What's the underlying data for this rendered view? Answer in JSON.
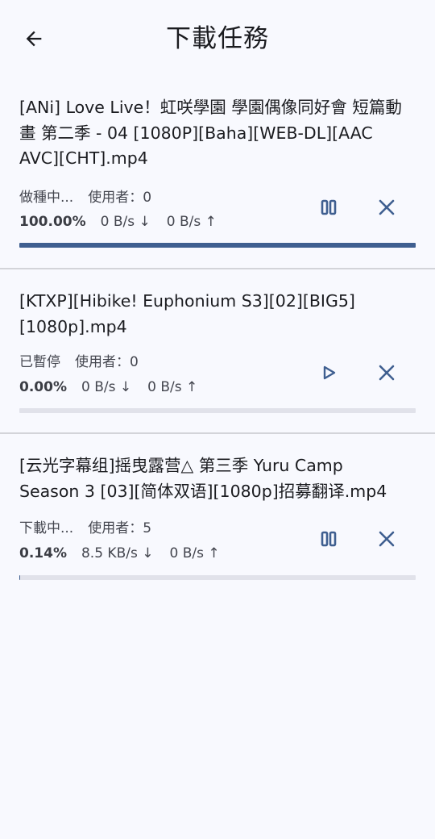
{
  "app_bar": {
    "title": "下載任務",
    "back_icon": "arrow-back-icon"
  },
  "colors": {
    "accent": "#3f5f90",
    "track": "#e1e2ea",
    "background": "#f8f9fe",
    "divider": "#d3d4d9"
  },
  "tasks": [
    {
      "name": "[ANi] Love Live！虹咲學園 學園偶像同好會 短篇動畫 第二季 - 04 [1080P][Baha][WEB-DL][AAC AVC][CHT].mp4",
      "status": "做種中...",
      "users": "使用者：0",
      "percent": "100.00%",
      "down": "0 B/s ↓",
      "up": "0 B/s ↑",
      "progress": 1.0,
      "primary_icon": "pause-icon",
      "cancel_icon": "close-icon"
    },
    {
      "name": "[KTXP][Hibike! Euphonium S3][02][BIG5][1080p].mp4",
      "status": "已暫停",
      "users": "使用者：0",
      "percent": "0.00%",
      "down": "0 B/s ↓",
      "up": "0 B/s ↑",
      "progress": 0.0,
      "primary_icon": "play-icon",
      "cancel_icon": "close-icon"
    },
    {
      "name": "[云光字幕组]摇曳露营△ 第三季  Yuru Camp Season 3 [03][简体双语][1080p]招募翻译.mp4",
      "status": "下載中...",
      "users": "使用者：5",
      "percent": "0.14%",
      "down": "8.5 KB/s ↓",
      "up": "0 B/s ↑",
      "progress": 0.0014,
      "primary_icon": "pause-icon",
      "cancel_icon": "close-icon"
    }
  ]
}
